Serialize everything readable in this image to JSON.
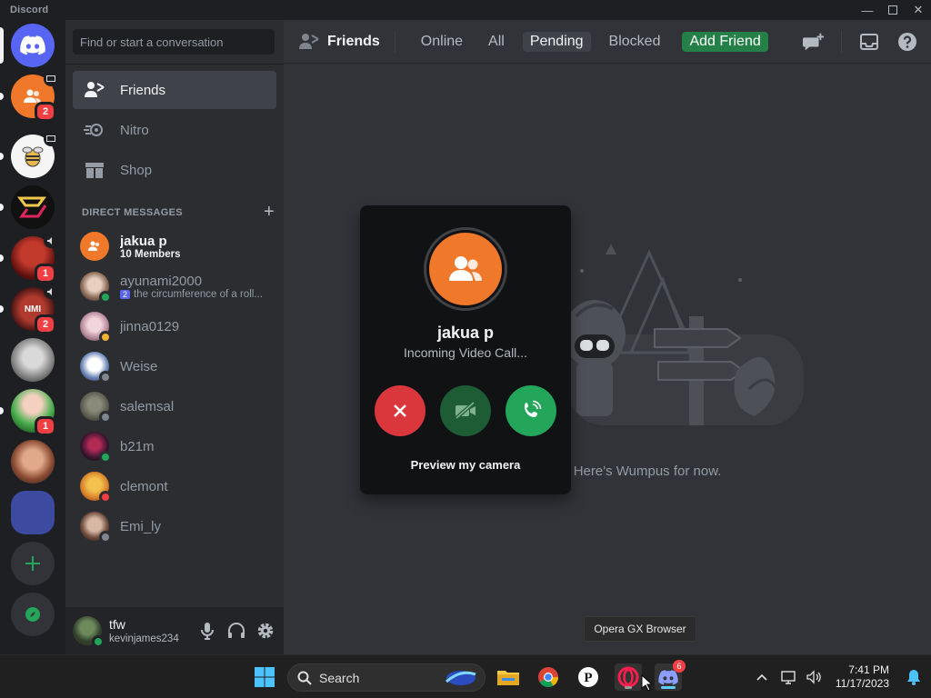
{
  "window": {
    "app_name": "Discord"
  },
  "search": {
    "placeholder": "Find or start a conversation"
  },
  "nav": {
    "friends": "Friends",
    "nitro": "Nitro",
    "shop": "Shop"
  },
  "direct_messages": {
    "header": "DIRECT MESSAGES",
    "items": [
      {
        "name": "jakua p",
        "sub": "10 Members",
        "status": "none"
      },
      {
        "name": "ayunami2000",
        "sub": "the circumference of a roll...",
        "status": "online",
        "sub_badge": "2"
      },
      {
        "name": "jinna0129",
        "sub": "",
        "status": "idle"
      },
      {
        "name": "Weise",
        "sub": "",
        "status": "offline"
      },
      {
        "name": "salemsal",
        "sub": "",
        "status": "offline"
      },
      {
        "name": "b21m",
        "sub": "",
        "status": "online"
      },
      {
        "name": "clemont",
        "sub": "",
        "status": "dnd"
      },
      {
        "name": "Emi_ly",
        "sub": "",
        "status": "offline"
      }
    ]
  },
  "servers": {
    "badges": [
      "2",
      "1",
      "2",
      "1"
    ]
  },
  "user": {
    "display_name": "tfw",
    "username": "kevinjames234"
  },
  "topbar": {
    "title": "Friends",
    "tabs": [
      "Online",
      "All",
      "Pending",
      "Blocked"
    ],
    "selected_tab": "Pending",
    "add_friend": "Add Friend"
  },
  "empty_state": {
    "text": "There are no pending friend requests. Here's Wumpus for now.",
    "visible_text": "nd requests. Here's Wumpus for now."
  },
  "call": {
    "name": "jakua p",
    "status": "Incoming Video Call...",
    "preview": "Preview my camera"
  },
  "tooltip": {
    "text": "Opera GX Browser"
  },
  "taskbar": {
    "search_label": "Search",
    "discord_badge": "6",
    "time": "7:41 PM",
    "date": "11/17/2023"
  },
  "colors": {
    "accent": "#5865f2",
    "green": "#248046",
    "red": "#da373c",
    "orange": "#f0782a"
  }
}
